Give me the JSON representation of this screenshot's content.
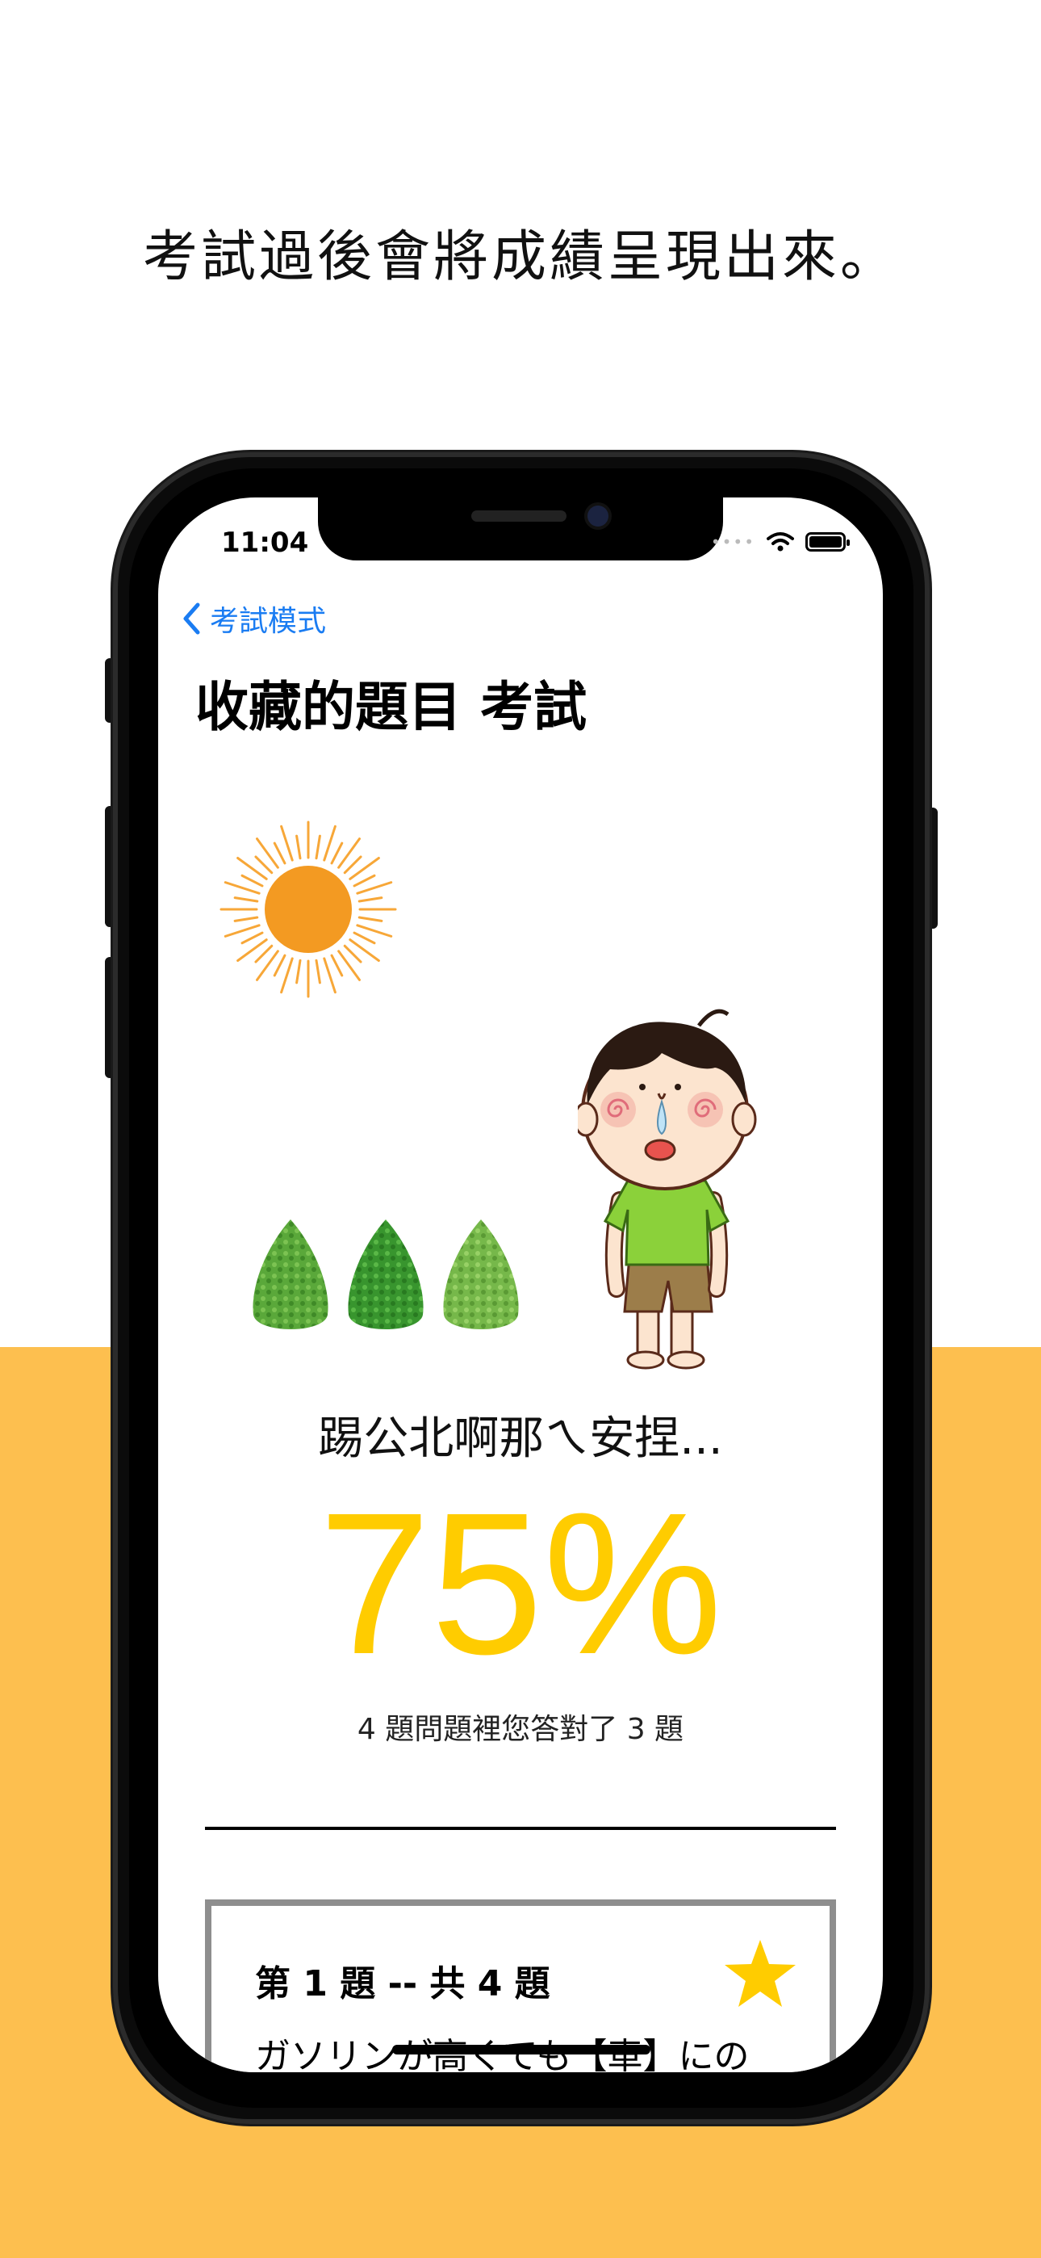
{
  "caption": "考試過後會將成績呈現出來。",
  "status_bar": {
    "time": "11:04"
  },
  "nav": {
    "back_label": "考試模式",
    "title": "收藏的題目 考試"
  },
  "result": {
    "message": "踢公北啊那ㄟ安捏...",
    "percent_text": "75%",
    "summary": "4 題問題裡您答對了 3 題"
  },
  "question_card": {
    "header": "第 1 題 -- 共 4 題",
    "text": "ガソリンが高くても【車】にの",
    "starred": true
  },
  "colors": {
    "accent_yellow": "#FFCC00",
    "background_orange": "#FDBF4F",
    "link_blue": "#1a7cf2"
  },
  "icons": [
    "back-chevron-icon",
    "wifi-icon",
    "battery-icon",
    "star-icon",
    "sun-illustration",
    "tree-illustration",
    "boy-illustration"
  ]
}
